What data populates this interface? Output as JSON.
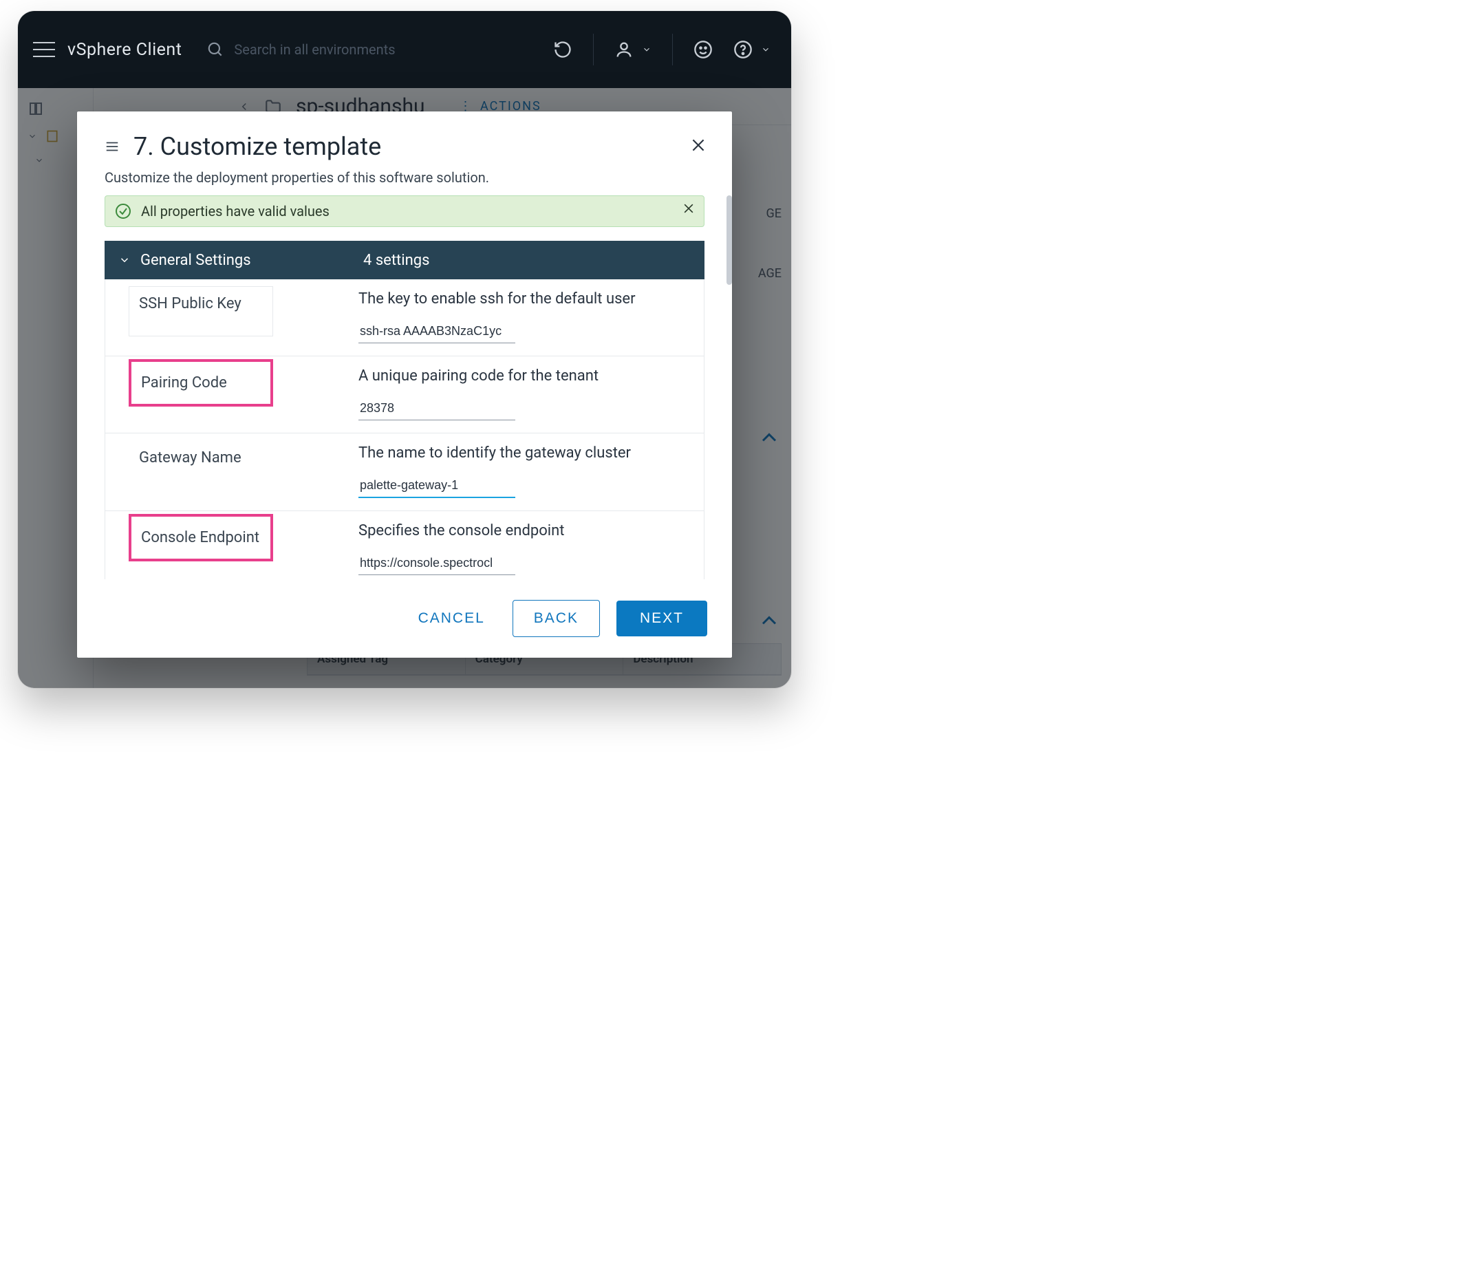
{
  "topbar": {
    "brand": "vSphere Client",
    "search_placeholder": "Search in all environments"
  },
  "bg": {
    "object_name": "sp-sudhanshu",
    "actions_label": "ACTIONS",
    "right_tab_frag_1": "GE",
    "right_tab_frag_2": "AGE",
    "table_headers": [
      "Assigned Tag",
      "Category",
      "Description"
    ]
  },
  "modal": {
    "title": "7. Customize template",
    "subtitle": "Customize the deployment properties of this software solution.",
    "alert_text": "All properties have valid values",
    "section_title": "General Settings",
    "settings_count_label": "4 settings",
    "rows": [
      {
        "label": "SSH Public Key",
        "desc": "The key to enable ssh for the default user",
        "value": "ssh-rsa AAAAB3NzaC1yc",
        "active": false,
        "highlight": false
      },
      {
        "label": "Pairing Code",
        "desc": "A unique  pairing code for the tenant",
        "value": "28378",
        "active": false,
        "highlight": true
      },
      {
        "label": "Gateway Name",
        "desc": "The name to identify the gateway cluster",
        "value": "palette-gateway-1",
        "active": true,
        "highlight": false
      },
      {
        "label": "Console Endpoint",
        "desc": "Specifies the console endpoint",
        "value": "https://console.spectrocl",
        "active": false,
        "highlight": true
      }
    ],
    "buttons": {
      "cancel": "CANCEL",
      "back": "BACK",
      "next": "NEXT"
    }
  }
}
